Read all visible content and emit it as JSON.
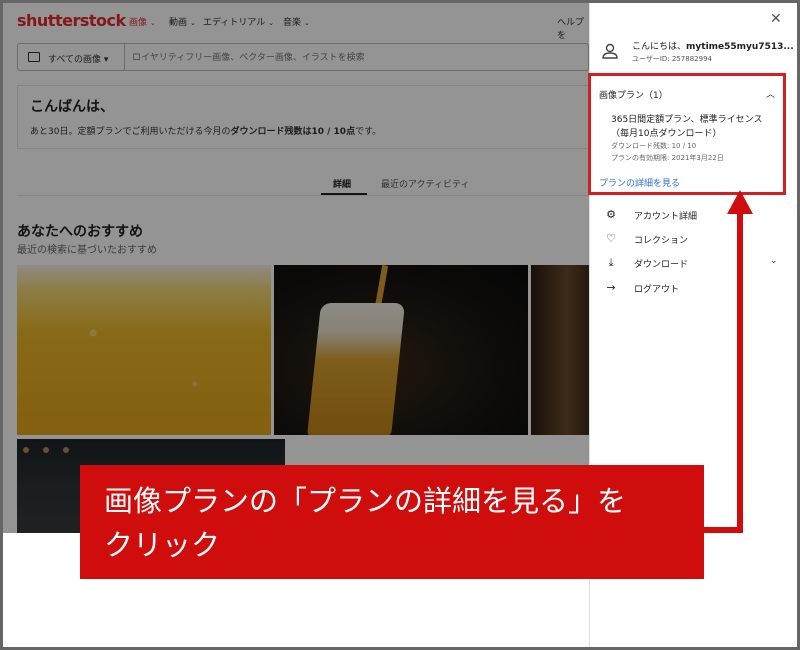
{
  "header": {
    "logo": "shutterstock",
    "nav": [
      "画像",
      "動画",
      "エディトリアル",
      "音楽"
    ],
    "help": "ヘルプを"
  },
  "search": {
    "type_label": "すべての画像",
    "placeholder": "ロイヤリティフリー画像、ベクター画像、イラストを検索"
  },
  "greeting": {
    "title": "こんばんは、",
    "text_prefix": "あと30日。定額プランでご利用いただける今月の",
    "text_bold": "ダウンロード残数は10 / 10点",
    "text_suffix": "です。"
  },
  "tabs": [
    "詳細",
    "最近のアクティビティ"
  ],
  "recommend": {
    "title": "あなたへのおすすめ",
    "subtitle": "最近の検索に基づいたおすすめ"
  },
  "panel": {
    "close": "✕",
    "hello_prefix": "こんにちは、",
    "username": "mytime55myu7513...",
    "user_id": "ユーザーID: 257882994",
    "plan": {
      "header": "画像プラン（1）",
      "line1": "365日間定額プラン、標準ライセンス",
      "line2": "（毎月10点ダウンロード）",
      "remaining": "ダウンロード残数: 10 / 10",
      "expiry": "プランの有効期限: 2021年3月22日",
      "link": "プランの詳細を見る"
    },
    "menu": [
      {
        "label": "アカウント詳細",
        "icon": "gear-icon"
      },
      {
        "label": "コレクション",
        "icon": "heart-icon"
      },
      {
        "label": "ダウンロード",
        "icon": "download-icon"
      },
      {
        "label": "ログアウト",
        "icon": "arrow-right-icon"
      }
    ]
  },
  "annotation": {
    "text": "画像プランの「プランの詳細を見る」を\nクリック",
    "color": "#d00d0d"
  }
}
